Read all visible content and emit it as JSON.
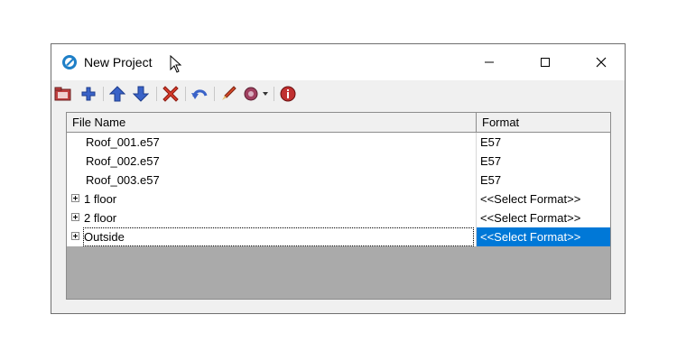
{
  "window": {
    "title": "New Project",
    "controls": {
      "minimize": "minimize-icon",
      "maximize": "maximize-icon",
      "close": "close-icon"
    }
  },
  "toolbar": {
    "buttons": [
      "open-folder-icon",
      "add-icon",
      "move-up-icon",
      "move-down-icon",
      "delete-icon",
      "undo-icon",
      "edit-icon",
      "settings-icon",
      "info-icon"
    ]
  },
  "grid": {
    "columns": [
      "File Name",
      "Format"
    ],
    "rows": [
      {
        "name": "Roof_001.e57",
        "format": "E57",
        "expandable": false
      },
      {
        "name": "Roof_002.e57",
        "format": "E57",
        "expandable": false
      },
      {
        "name": "Roof_003.e57",
        "format": "E57",
        "expandable": false
      },
      {
        "name": "1 floor",
        "format": "<<Select Format>>",
        "expandable": true
      },
      {
        "name": "2 floor",
        "format": "<<Select Format>>",
        "expandable": true
      },
      {
        "name": "Outside",
        "format": "<<Select Format>>",
        "expandable": true,
        "selected": true
      }
    ]
  },
  "colors": {
    "selection": "#0078d7",
    "empty_area": "#aaaaaa",
    "header": "#f0f0f0"
  }
}
